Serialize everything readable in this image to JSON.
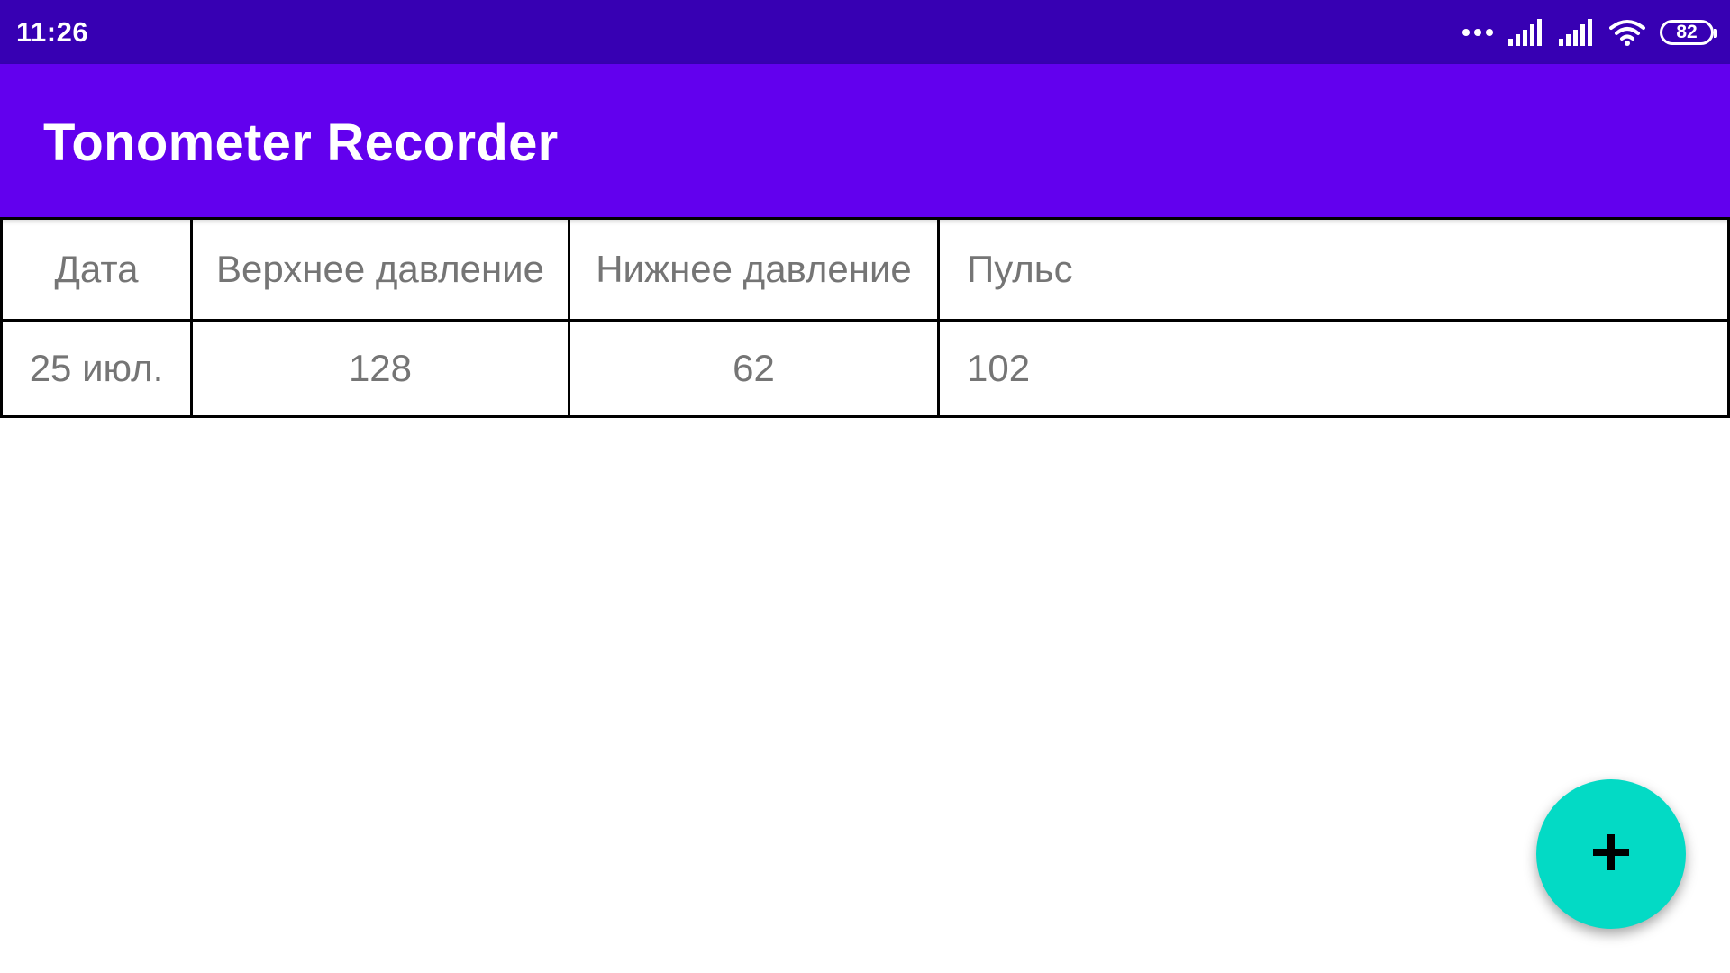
{
  "status_bar": {
    "time": "11:26",
    "battery": "82",
    "icons": [
      "more-dots-icon",
      "signal-icon",
      "signal-icon",
      "wifi-icon",
      "battery-icon"
    ]
  },
  "app_bar": {
    "title": "Tonometer Recorder"
  },
  "table": {
    "headers": [
      "Дата",
      "Верхнее давление",
      "Нижнее давление",
      "Пульс"
    ],
    "rows": [
      [
        "25 июл.",
        "128",
        "62",
        "102"
      ]
    ]
  },
  "fab": {
    "icon": "plus-icon"
  },
  "colors": {
    "status_bar": "#3700b3",
    "app_bar": "#6200ee",
    "fab": "#03dac5",
    "cell_text": "#757575"
  }
}
